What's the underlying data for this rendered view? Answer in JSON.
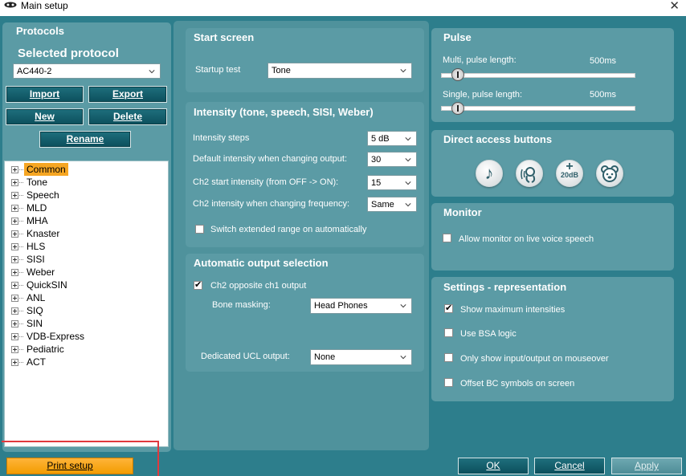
{
  "window": {
    "title": "Main setup",
    "close_glyph": "✕"
  },
  "protocols": {
    "header": "Protocols",
    "selected_label": "Selected protocol",
    "selected_value": "AC440-2",
    "buttons": {
      "import": "Import",
      "export": "Export",
      "new": "New",
      "delete": "Delete",
      "rename": "Rename"
    },
    "tree": [
      "Common",
      "Tone",
      "Speech",
      "MLD",
      "MHA",
      "Knaster",
      "HLS",
      "SISI",
      "Weber",
      "QuickSIN",
      "ANL",
      "SIQ",
      "SIN",
      "VDB-Express",
      "Pediatric",
      "ACT"
    ],
    "tree_selected": "Common"
  },
  "start_screen": {
    "header": "Start screen",
    "startup_test_label": "Startup test",
    "startup_test_value": "Tone"
  },
  "intensity": {
    "header": "Intensity (tone, speech, SISI, Weber)",
    "steps_label": "Intensity steps",
    "steps_value": "5 dB",
    "default_label": "Default intensity when changing output:",
    "default_value": "30",
    "ch2_start_label": "Ch2 start intensity (from OFF -> ON):",
    "ch2_start_value": "15",
    "ch2_freq_label": "Ch2 intensity when changing frequency:",
    "ch2_freq_value": "Same",
    "extended_label": "Switch extended range on automatically",
    "extended_checked": false
  },
  "auto_output": {
    "header": "Automatic output selection",
    "ch2_opposite_label": "Ch2 opposite ch1 output",
    "ch2_opposite_checked": true,
    "bone_masking_label": "Bone masking:",
    "bone_masking_value": "Head Phones",
    "ucl_label": "Dedicated UCL output:",
    "ucl_value": "None"
  },
  "pulse": {
    "header": "Pulse",
    "multi_label": "Multi, pulse length:",
    "multi_value": "500ms",
    "single_label": "Single, pulse length:",
    "single_value": "500ms"
  },
  "direct_access": {
    "header": "Direct access buttons",
    "buttons": [
      {
        "icon": "music-note-icon",
        "text": "♪"
      },
      {
        "icon": "talk-icon",
        "text": ""
      },
      {
        "icon": "plus-20db-icon",
        "text": "20dB"
      },
      {
        "icon": "pediatric-bear-icon",
        "text": ""
      }
    ]
  },
  "monitor": {
    "header": "Monitor",
    "live_voice_label": "Allow monitor on live voice speech",
    "live_voice_checked": false
  },
  "settings": {
    "header": "Settings - representation",
    "options": [
      {
        "label": "Show maximum intensities",
        "checked": true
      },
      {
        "label": "Use BSA logic",
        "checked": false
      },
      {
        "label": "Only show input/output on mouseover",
        "checked": false
      },
      {
        "label": "Offset BC symbols on screen",
        "checked": false
      }
    ]
  },
  "footer": {
    "print": "Print setup",
    "ok": "OK",
    "cancel": "Cancel",
    "apply": "Apply"
  },
  "colors": {
    "background": "#2d7e8c",
    "panel": "#5b9ba5",
    "selected": "#f6a623",
    "highlight": "#e0393e"
  }
}
